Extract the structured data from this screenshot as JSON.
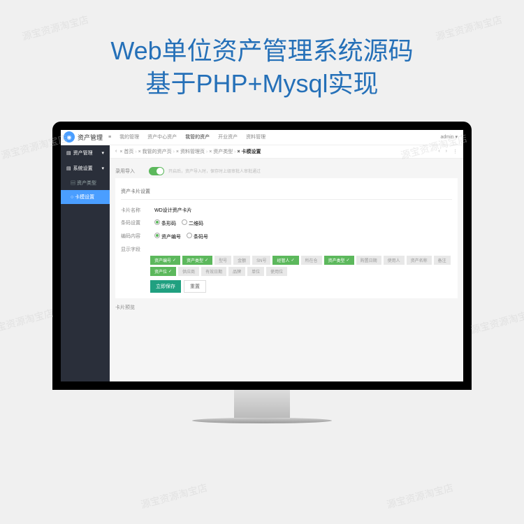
{
  "watermark": "源宝资源淘宝店",
  "title": {
    "line1": "Web单位资产管理系统源码",
    "line2": "基于PHP+Mysql实现"
  },
  "app": {
    "name": "资产管理",
    "hamburger": "≡",
    "tabs": [
      "我的管理",
      "资产中心资产",
      "我管的资产",
      "开业资产",
      "资料管理"
    ],
    "active_tab": 2,
    "user": "admin ▾"
  },
  "sidebar": {
    "items": [
      {
        "icon": "▤",
        "label": "资产管理",
        "arrow": "▾"
      },
      {
        "icon": "▤",
        "label": "系统设置",
        "arrow": "▾"
      }
    ],
    "subs": [
      {
        "icon": "▤",
        "label": "资产类型"
      },
      {
        "icon": "○",
        "label": "卡模设置"
      }
    ],
    "active_sub": 1
  },
  "breadcrumb": {
    "items": [
      "首页",
      "我管的资产页",
      "资料管理页",
      "资产类型",
      "卡模设置"
    ],
    "back": "‹",
    "nav": [
      "‹",
      "›",
      "⋮"
    ]
  },
  "form": {
    "approver_label": "录用导入",
    "approver_hint": "开启后，资产导入时，保存时上级审批人审批通过",
    "section": "资产卡片设置",
    "card_name_label": "卡片名称",
    "card_name_value": "WD设计资产卡片",
    "code_label": "条码设置",
    "code_options": [
      "条形码",
      "二维码"
    ],
    "code_selected": 0,
    "content_label": "编码内容",
    "content_options": [
      "资产编号",
      "条码号"
    ],
    "content_selected": 0,
    "display_label": "显示字段",
    "fields": [
      {
        "label": "资产编号",
        "on": true
      },
      {
        "label": "资产类型",
        "on": true
      },
      {
        "label": "型号",
        "on": false
      },
      {
        "label": "金额",
        "on": false
      },
      {
        "label": "SN号",
        "on": false
      },
      {
        "label": "经管人",
        "on": true
      },
      {
        "label": "所在仓",
        "on": false
      },
      {
        "label": "资产类型",
        "on": true
      },
      {
        "label": "购置日期",
        "on": false
      },
      {
        "label": "使用人",
        "on": false
      },
      {
        "label": "资产名称",
        "on": false
      },
      {
        "label": "备注",
        "on": false
      },
      {
        "label": "资产位",
        "on": true
      },
      {
        "label": "供应商",
        "on": false
      },
      {
        "label": "有效日期",
        "on": false
      },
      {
        "label": "品牌",
        "on": false
      },
      {
        "label": "单位",
        "on": false
      },
      {
        "label": "使用位",
        "on": false
      }
    ],
    "buttons": {
      "save": "立即保存",
      "reset": "重置"
    },
    "preview": "卡片预览"
  }
}
